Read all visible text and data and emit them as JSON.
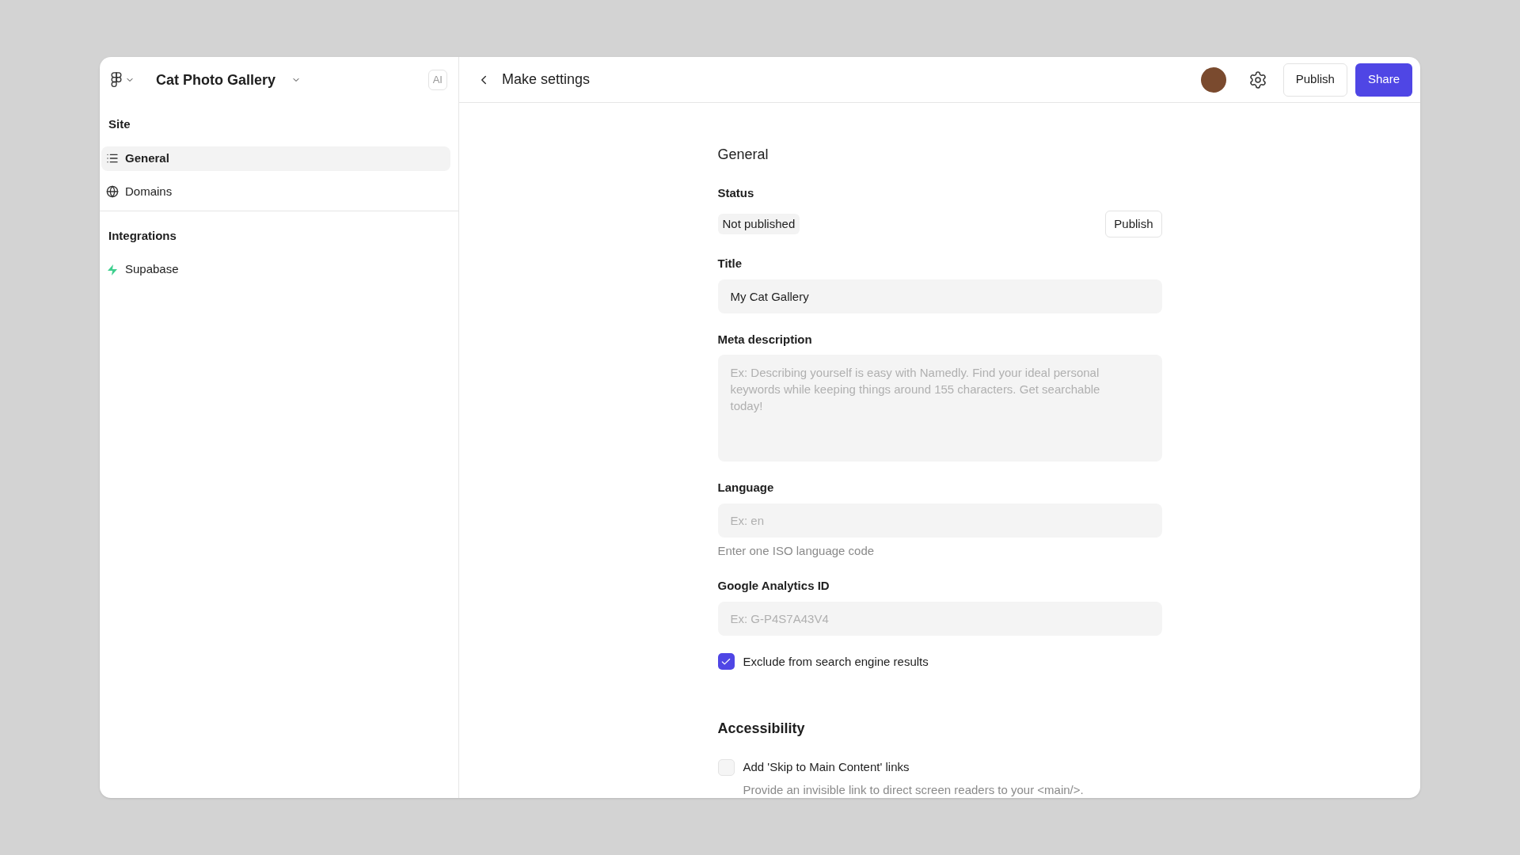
{
  "sidebar": {
    "project_title": "Cat Photo Gallery",
    "ai_badge": "AI",
    "sections": [
      {
        "title": "Site",
        "items": [
          {
            "label": "General",
            "kind": "list",
            "selected": true
          },
          {
            "label": "Domains",
            "kind": "globe",
            "selected": false
          }
        ]
      },
      {
        "title": "Integrations",
        "items": [
          {
            "label": "Supabase",
            "kind": "bolt",
            "selected": false
          }
        ]
      }
    ]
  },
  "header": {
    "title": "Make settings",
    "publish_button": "Publish",
    "share_button": "Share"
  },
  "sections": [
    {
      "heading": "General",
      "items": [
        {
          "kind": "status",
          "label": "Status",
          "badge": "Not published",
          "button": "Publish"
        },
        {
          "kind": "input",
          "label": "Title",
          "value": "My Cat Gallery"
        },
        {
          "kind": "textarea",
          "label": "Meta description",
          "placeholder": "Ex: Describing yourself is easy with Namedly. Find your ideal personal keywords while keeping things around 155 characters. Get searchable today!"
        },
        {
          "kind": "input",
          "label": "Language",
          "placeholder": "Ex: en",
          "hint": "Enter one ISO language code"
        },
        {
          "kind": "input",
          "label": "Google Analytics ID",
          "placeholder": "Ex: G-P4S7A43V4"
        },
        {
          "kind": "checkbox",
          "label": "Exclude from search engine results",
          "checked": true
        }
      ]
    },
    {
      "heading": "Accessibility",
      "items": [
        {
          "kind": "checkbox",
          "label": "Add 'Skip to Main Content' links",
          "checked": false,
          "hint": "Provide an invisible link to direct screen readers to your <main/>."
        }
      ]
    }
  ]
}
